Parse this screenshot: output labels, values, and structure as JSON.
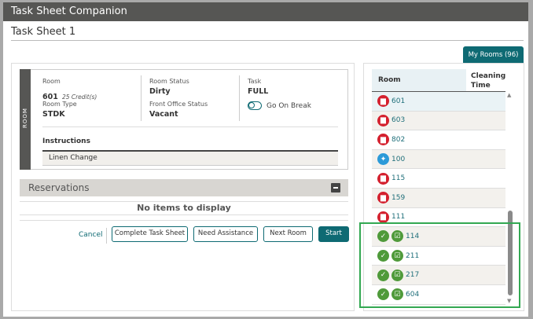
{
  "window": {
    "title": "Task Sheet Companion"
  },
  "sheet": {
    "title": "Task Sheet 1"
  },
  "room_card": {
    "section_label": "ROOM",
    "room_label": "Room",
    "room_value": "601",
    "credits": "25 Credit(s)",
    "room_type_label": "Room Type",
    "room_type_value": "STDK",
    "room_status_label": "Room Status",
    "room_status_value": "Dirty",
    "fo_status_label": "Front Office Status",
    "fo_status_value": "Vacant",
    "task_label": "Task",
    "task_value": "FULL",
    "break_toggle_label": "Go On Break",
    "break_toggle_on": false,
    "instructions_header": "Instructions",
    "instructions": [
      "Linen Change"
    ]
  },
  "reservations": {
    "title": "Reservations",
    "empty_text": "No items to display"
  },
  "actions": {
    "cancel": "Cancel",
    "complete": "Complete Task Sheet",
    "assist": "Need Assistance",
    "next": "Next Room",
    "start": "Start"
  },
  "rooms_panel": {
    "tab_label": "My Rooms (96)",
    "col_room": "Room",
    "col_time": "Cleaning Time",
    "rows": [
      {
        "room": "601",
        "icon": "dirty-icon"
      },
      {
        "room": "603",
        "icon": "dirty-icon"
      },
      {
        "room": "802",
        "icon": "dirty-icon"
      },
      {
        "room": "100",
        "icon": "clean-icon"
      },
      {
        "room": "115",
        "icon": "dirty-icon"
      },
      {
        "room": "159",
        "icon": "dirty-icon"
      },
      {
        "room": "111",
        "icon": "dirty-icon"
      },
      {
        "room": "114",
        "icon": "completed-icon"
      },
      {
        "room": "211",
        "icon": "completed-icon"
      },
      {
        "room": "217",
        "icon": "completed-icon"
      },
      {
        "room": "604",
        "icon": "completed-icon"
      }
    ]
  },
  "colors": {
    "accent": "#0e6a73",
    "dirty": "#d4202e",
    "clean": "#2c9ad8",
    "done": "#4f9a3a",
    "highlight": "#33a852"
  }
}
